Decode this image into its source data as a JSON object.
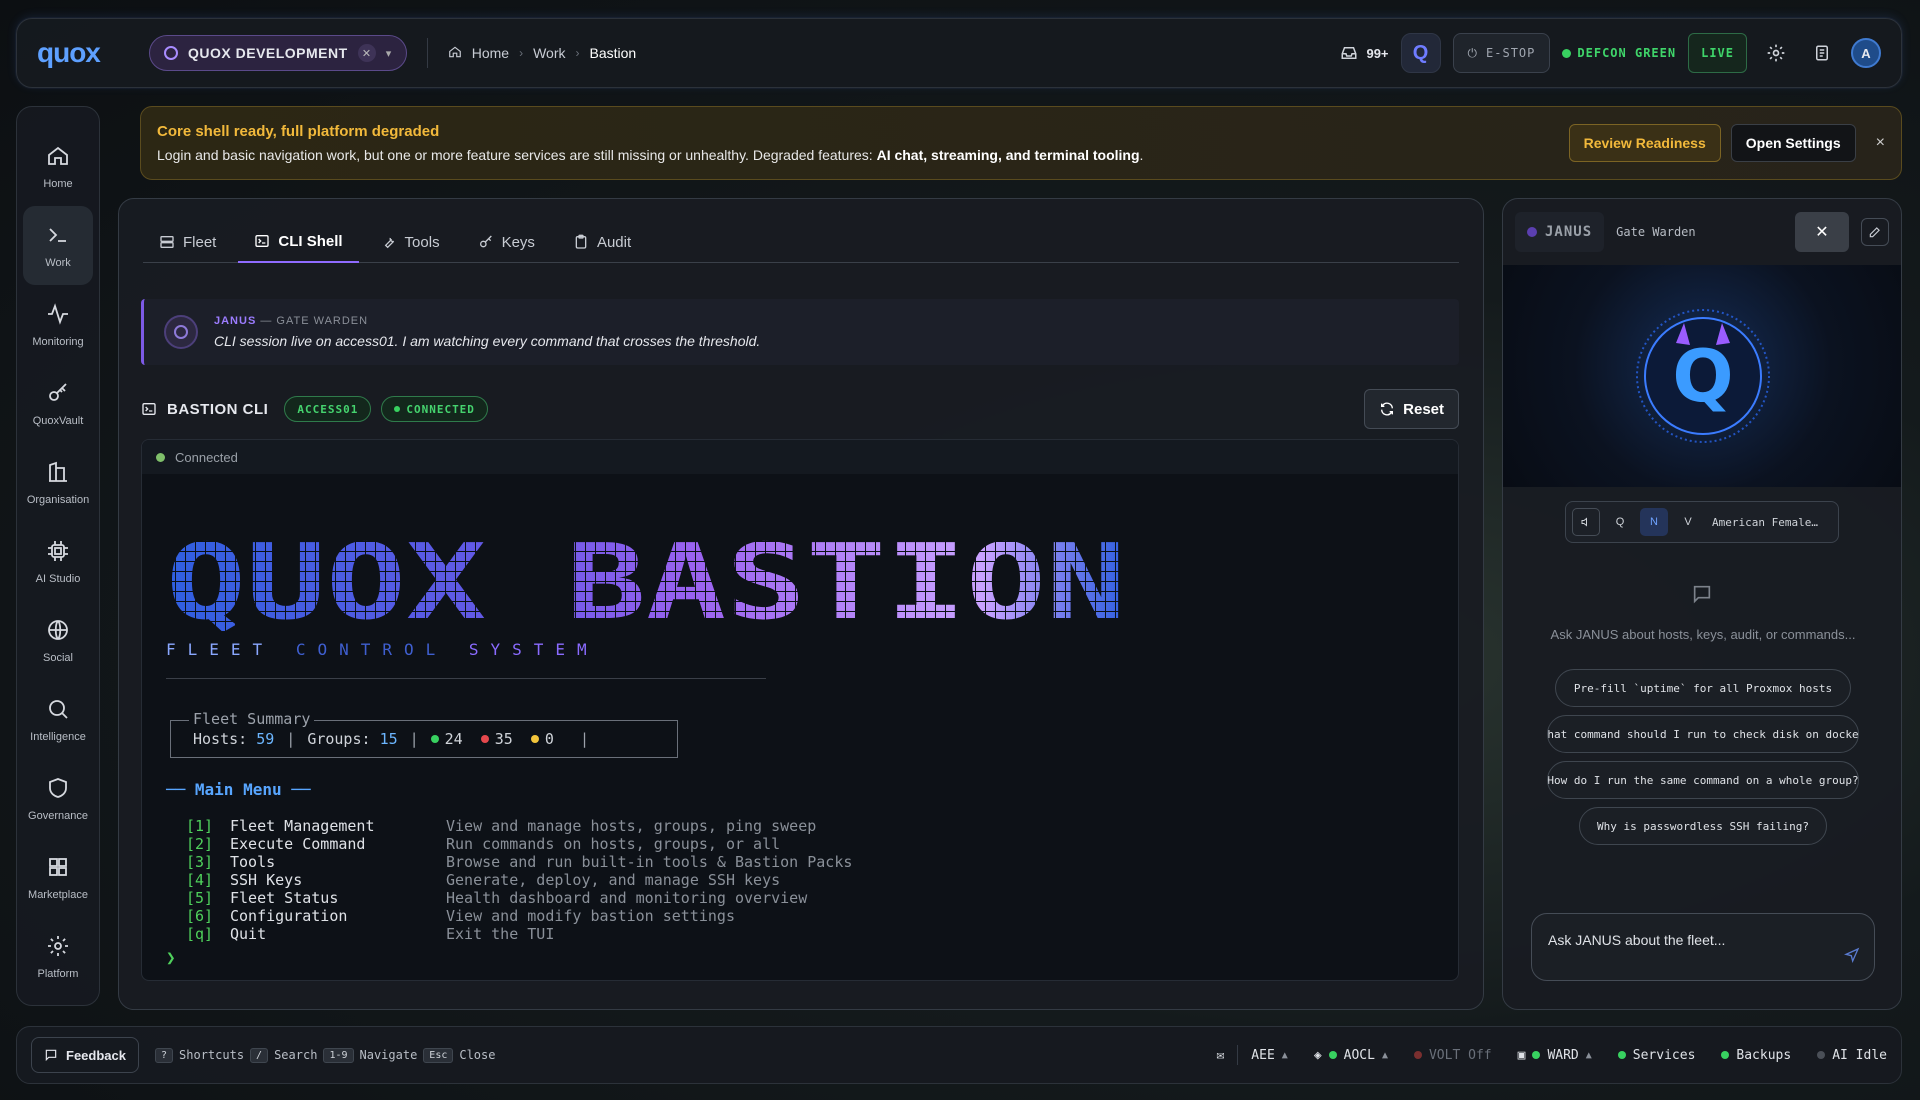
{
  "app": {
    "logo": "quox"
  },
  "topbar": {
    "project": "QUOX DEVELOPMENT",
    "breadcrumbs": [
      "Home",
      "Work",
      "Bastion"
    ],
    "inbox_count": "99+",
    "q_label": "Q",
    "estop": "E-STOP",
    "defcon": "DEFCON GREEN",
    "live": "LIVE",
    "avatar": "A"
  },
  "sidenav": {
    "items": [
      {
        "label": "Home",
        "icon": "home-icon"
      },
      {
        "label": "Work",
        "icon": "terminal-icon",
        "active": true
      },
      {
        "label": "Monitoring",
        "icon": "pulse-icon"
      },
      {
        "label": "QuoxVault",
        "icon": "key-icon"
      },
      {
        "label": "Organisation",
        "icon": "building-icon"
      },
      {
        "label": "AI Studio",
        "icon": "chip-icon"
      },
      {
        "label": "Social",
        "icon": "globe-icon"
      },
      {
        "label": "Intelligence",
        "icon": "search-icon"
      },
      {
        "label": "Governance",
        "icon": "shield-icon"
      },
      {
        "label": "Marketplace",
        "icon": "grid-icon"
      },
      {
        "label": "Platform",
        "icon": "gear-icon"
      }
    ]
  },
  "banner": {
    "title": "Core shell ready, full platform degraded",
    "text": "Login and basic navigation work, but one or more feature services are still missing or unhealthy. Degraded features: ",
    "features": "AI chat, streaming, and terminal tooling",
    "end": ".",
    "review": "Review Readiness",
    "open": "Open Settings",
    "close": "×"
  },
  "tabs": [
    {
      "label": "Fleet",
      "icon": "server-icon"
    },
    {
      "label": "CLI Shell",
      "icon": "terminal-square-icon",
      "active": true
    },
    {
      "label": "Tools",
      "icon": "wrench-icon"
    },
    {
      "label": "Keys",
      "icon": "key-icon"
    },
    {
      "label": "Audit",
      "icon": "clipboard-icon"
    }
  ],
  "janus_message": {
    "name": "JANUS",
    "role": " — GATE WARDEN",
    "text": "CLI session live on access01. I am watching every command that crosses the threshold."
  },
  "cli": {
    "title": "BASTION CLI",
    "host_badge": "ACCESS01",
    "status_badge": "CONNECTED",
    "reset": "Reset",
    "term_status": "Connected",
    "banner_word1": "QUOX",
    "banner_word2": "BASTION",
    "subtitle": [
      "FLEET",
      "CONTROL",
      "SYSTEM"
    ],
    "summary_legend": "Fleet Summary",
    "hosts_label": "Hosts:",
    "hosts": "59",
    "groups_label": "Groups:",
    "groups": "15",
    "green": "24",
    "red": "35",
    "yellow": "0",
    "bar": "|",
    "menu_title": "── Main Menu ──",
    "menu": [
      {
        "key": "[1]",
        "name": "Fleet Management",
        "desc": "View and manage hosts, groups, ping sweep"
      },
      {
        "key": "[2]",
        "name": "Execute Command",
        "desc": "Run commands on hosts, groups, or all"
      },
      {
        "key": "[3]",
        "name": "Tools",
        "desc": "Browse and run built-in tools & Bastion Packs"
      },
      {
        "key": "[4]",
        "name": "SSH Keys",
        "desc": "Generate, deploy, and manage SSH keys"
      },
      {
        "key": "[5]",
        "name": "Fleet Status",
        "desc": "Health dashboard and monitoring overview"
      },
      {
        "key": "[6]",
        "name": "Configuration",
        "desc": "View and modify bastion settings"
      },
      {
        "key": "[q]",
        "name": "Quit",
        "desc": "Exit the TUI"
      }
    ],
    "prompt": "❯"
  },
  "janus_panel": {
    "name": "JANUS",
    "role": "Gate Warden",
    "voice_modes": [
      "Q",
      "N",
      "V"
    ],
    "voice_name": "American Female…",
    "hint": "Ask JANUS about hosts, keys, audit, or commands...",
    "suggestions": [
      "Pre-fill `uptime` for all Proxmox hosts",
      "What command should I run to check disk on docker",
      "How do I run the same command on a whole group?",
      "Why is passwordless SSH failing?"
    ],
    "input_placeholder": "Ask JANUS about the fleet..."
  },
  "bottombar": {
    "feedback": "Feedback",
    "shortcuts": [
      {
        "key": "?",
        "label": "Shortcuts"
      },
      {
        "key": "/",
        "label": "Search"
      },
      {
        "key": "1-9",
        "label": "Navigate"
      },
      {
        "key": "Esc",
        "label": "Close"
      }
    ],
    "status": {
      "aee": "AEE",
      "aocl": "AOCL",
      "volt": "VOLT Off",
      "ward": "WARD",
      "services": "Services",
      "backups": "Backups",
      "ai": "AI Idle"
    }
  },
  "colors": {
    "accent": "#8f6bff",
    "ok": "#38d160",
    "warn": "#f2b93b",
    "error": "#e5484d",
    "link": "#58a6ff"
  }
}
